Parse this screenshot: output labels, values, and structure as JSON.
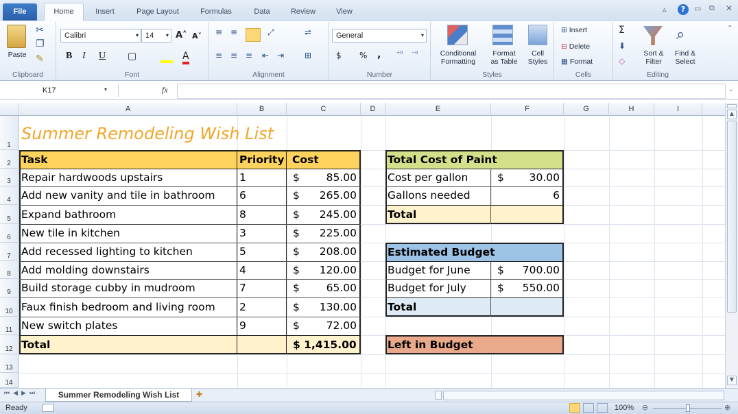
{
  "ribbon_tabs": [
    "File",
    "Home",
    "Insert",
    "Page Layout",
    "Formulas",
    "Data",
    "Review",
    "View"
  ],
  "ribbon": {
    "clipboard": {
      "paste": "Paste",
      "label": "Clipboard"
    },
    "font": {
      "name": "Calibri",
      "size": "14",
      "label": "Font",
      "bold": "B",
      "italic": "I",
      "underline": "U"
    },
    "alignment": {
      "label": "Alignment"
    },
    "number": {
      "format": "General",
      "dollar": "$",
      "percent": "%",
      "comma": ",",
      "label": "Number"
    },
    "styles": {
      "cond1": "Conditional",
      "cond2": "Formatting",
      "fmt1": "Format",
      "fmt2": "as Table",
      "cell1": "Cell",
      "cell2": "Styles",
      "label": "Styles"
    },
    "cells": {
      "insert": "Insert",
      "delete": "Delete",
      "format": "Format",
      "label": "Cells"
    },
    "editing": {
      "sort1": "Sort &",
      "sort2": "Filter",
      "find1": "Find &",
      "find2": "Select",
      "label": "Editing",
      "sum": "Σ"
    }
  },
  "formula_bar": {
    "name_box": "K17",
    "fx": "fx",
    "value": ""
  },
  "columns": [
    "A",
    "B",
    "C",
    "D",
    "E",
    "F",
    "G",
    "H",
    "I"
  ],
  "rows": [
    "1",
    "2",
    "3",
    "4",
    "5",
    "6",
    "7",
    "8",
    "9",
    "10",
    "11",
    "12",
    "13",
    "14"
  ],
  "sheet": {
    "title": "Summer Remodeling Wish List",
    "headers": {
      "task": "Task",
      "priority": "Priority",
      "cost": "Cost"
    },
    "tasks": [
      {
        "task": "Repair hardwoods upstairs",
        "priority": "1",
        "cur": "$",
        "cost": "85.00"
      },
      {
        "task": "Add new vanity and tile in bathroom",
        "priority": "6",
        "cur": "$",
        "cost": "265.00"
      },
      {
        "task": "Expand bathroom",
        "priority": "8",
        "cur": "$",
        "cost": "245.00"
      },
      {
        "task": "New tile in kitchen",
        "priority": "3",
        "cur": "$",
        "cost": "225.00"
      },
      {
        "task": "Add recessed lighting to kitchen",
        "priority": "5",
        "cur": "$",
        "cost": "208.00"
      },
      {
        "task": "Add molding downstairs",
        "priority": "4",
        "cur": "$",
        "cost": "120.00"
      },
      {
        "task": "Build storage cubby in mudroom",
        "priority": "7",
        "cur": "$",
        "cost": "65.00"
      },
      {
        "task": "Faux finish bedroom and living room",
        "priority": "2",
        "cur": "$",
        "cost": "130.00"
      },
      {
        "task": "New switch plates",
        "priority": "9",
        "cur": "$",
        "cost": "72.00"
      }
    ],
    "total_label": "Total",
    "total_value": "$ 1,415.00",
    "paint": {
      "header": "Total Cost of Paint",
      "cpg_label": "Cost per gallon",
      "cpg_cur": "$",
      "cpg_value": "30.00",
      "gal_label": "Gallons needed",
      "gal_value": "6",
      "total_label": "Total"
    },
    "budget": {
      "header": "Estimated Budget",
      "june_label": "Budget for June",
      "june_cur": "$",
      "june_value": "700.00",
      "july_label": "Budget for July",
      "july_cur": "$",
      "july_value": "550.00",
      "total_label": "Total"
    },
    "left": "Left in Budget"
  },
  "sheet_tab": "Summer Remodeling Wish List",
  "status": {
    "ready": "Ready",
    "zoom": "100%"
  },
  "colors": {
    "yellow": "#fdd35e",
    "light_yellow": "#fff2cc",
    "green": "#d4df8a",
    "blue": "#9dc3e6",
    "light_blue": "#deebf7",
    "salmon": "#e9a98a",
    "title": "#f1a62a"
  }
}
